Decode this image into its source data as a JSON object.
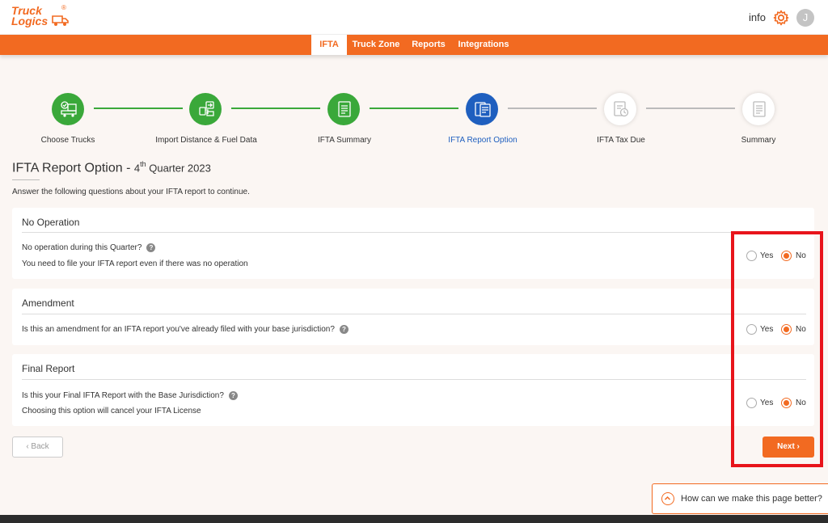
{
  "header": {
    "logo_line1": "Truck",
    "logo_line2": "Logics",
    "logo_reg": "®",
    "info_label": "info",
    "avatar_initial": "J"
  },
  "nav": {
    "items": [
      "IFTA",
      "Truck Zone",
      "Reports",
      "Integrations"
    ],
    "active": "IFTA"
  },
  "steps": [
    {
      "label": "Choose Trucks",
      "state": "done"
    },
    {
      "label": "Import Distance & Fuel Data",
      "state": "done"
    },
    {
      "label": "IFTA Summary",
      "state": "done"
    },
    {
      "label": "IFTA Report Option",
      "state": "current"
    },
    {
      "label": "IFTA Tax Due",
      "state": "pending"
    },
    {
      "label": "Summary",
      "state": "pending"
    }
  ],
  "page": {
    "title": "IFTA Report Option - ",
    "quarter_num": "4",
    "quarter_sup": "th",
    "quarter_rest": " Quarter 2023",
    "subtitle": "Answer the following questions about your IFTA report to continue."
  },
  "sections": [
    {
      "title": "No Operation",
      "question": "No operation during this Quarter?",
      "note": "You need to file your IFTA report even if there was no operation",
      "selected": "No"
    },
    {
      "title": "Amendment",
      "question": "Is this an amendment for an IFTA report you've already filed with your base jurisdiction?",
      "note": "",
      "selected": "No"
    },
    {
      "title": "Final Report",
      "question": "Is this your Final IFTA Report with the Base Jurisdiction?",
      "note": "Choosing this option will cancel your IFTA License",
      "selected": "No"
    }
  ],
  "options": {
    "yes": "Yes",
    "no": "No"
  },
  "help_glyph": "?",
  "buttons": {
    "back": "‹ Back",
    "next": "Next ›"
  },
  "feedback": {
    "text": "How can we make this page better?"
  },
  "colors": {
    "brand": "#f26a21",
    "done": "#3aa83a",
    "current": "#1f5fbf",
    "highlight": "#e8141b"
  }
}
